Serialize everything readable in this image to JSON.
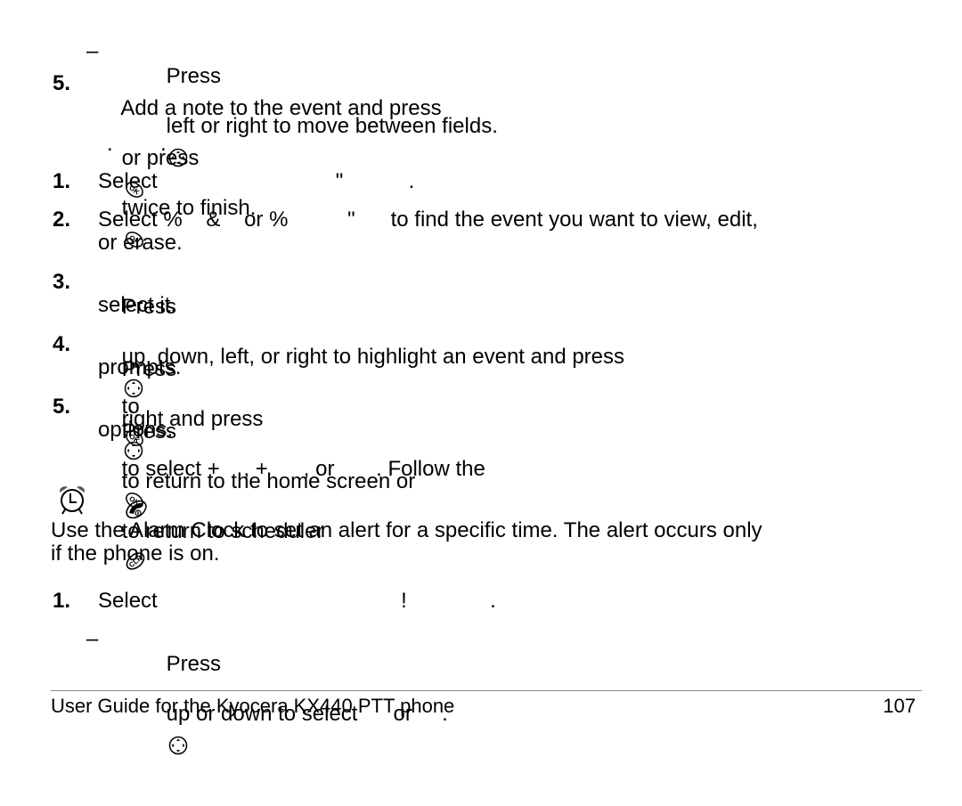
{
  "document": {
    "top_sub_step": {
      "dash": "–",
      "before_icon": "Press",
      "icon": "navigation-key-icon",
      "after_icon": "left or right to move between fields."
    },
    "step5_top": {
      "number": "5.",
      "text_a": "Add a note to the event and press",
      "icon_a": "ok-key-icon",
      "text_b": "or press",
      "icon_b": "ok-key-icon",
      "text_c": "twice to finish."
    },
    "section_heading_fragment": ".        .",
    "steps": [
      {
        "number": "1.",
        "lines": [
          "Select                              \"           ."
        ]
      },
      {
        "number": "2.",
        "lines": [
          "Select %    &    or %          \"      to find the event you want to view, edit,",
          "or erase."
        ]
      },
      {
        "number": "3.",
        "line1_a": "Press",
        "line1_icon_a": "navigation-key-icon",
        "line1_b": "up, down, left, or right to highlight an event and press",
        "line1_icon_b": "ok-key-icon",
        "line1_c": "to",
        "line2": "select it."
      },
      {
        "number": "4.",
        "line1_a": "Press",
        "line1_icon_a": "navigation-key-icon",
        "line1_b": "right and press",
        "line1_icon_b": "ok-key-icon",
        "line1_c": "to select +    , +      , or       . Follow the",
        "line2": "prompts."
      },
      {
        "number": "5.",
        "line1_a": "Press",
        "line1_icon_a": "end-key-icon",
        "line1_b": "to return to the home screen or",
        "line1_icon_b": "clr-key-icon",
        "line1_c": "to return to scheduler",
        "line2": "options."
      }
    ],
    "alarm_section": {
      "icon": "alarm-clock-icon",
      "intro_line1": "Use the Alarm Clock to set an alert for a specific time. The alert occurs only",
      "intro_line2": "if the phone is on.",
      "step1": {
        "number": "1.",
        "text": "Select                                         !              ."
      },
      "sub_step": {
        "dash": "–",
        "before_icon": "Press",
        "icon": "navigation-key-icon",
        "after_icon": "up or down to select      or     ."
      }
    }
  },
  "footer": {
    "title": "User Guide for the Kyocera KX440 PTT phone",
    "page_number": "107"
  }
}
